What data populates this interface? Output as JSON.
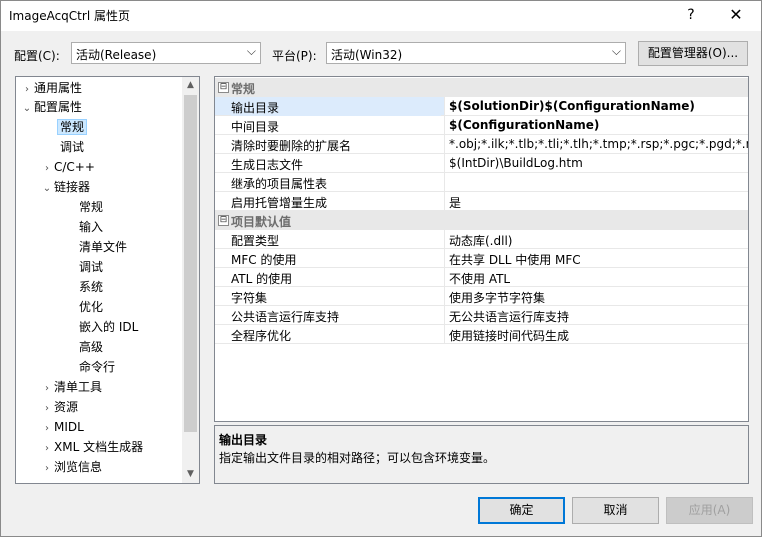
{
  "window": {
    "title": "ImageAcqCtrl 属性页",
    "help": "?",
    "close": "✕"
  },
  "toolbar": {
    "config_label": "配置(C):",
    "config_value": "活动(Release)",
    "platform_label": "平台(P):",
    "platform_value": "活动(Win32)",
    "config_manager": "配置管理器(O)..."
  },
  "tree": {
    "items": [
      {
        "label": "通用属性",
        "expander": "›"
      },
      {
        "label": "配置属性",
        "expander": "⌄"
      },
      {
        "label": "常规"
      },
      {
        "label": "调试"
      },
      {
        "label": "C/C++",
        "expander": "›"
      },
      {
        "label": "链接器",
        "expander": "⌄"
      },
      {
        "label": "常规"
      },
      {
        "label": "输入"
      },
      {
        "label": "清单文件"
      },
      {
        "label": "调试"
      },
      {
        "label": "系统"
      },
      {
        "label": "优化"
      },
      {
        "label": "嵌入的 IDL"
      },
      {
        "label": "高级"
      },
      {
        "label": "命令行"
      },
      {
        "label": "清单工具",
        "expander": "›"
      },
      {
        "label": "资源",
        "expander": "›"
      },
      {
        "label": "MIDL",
        "expander": "›"
      },
      {
        "label": "XML 文档生成器",
        "expander": "›"
      },
      {
        "label": "浏览信息",
        "expander": "›"
      }
    ]
  },
  "grid": {
    "categories": [
      {
        "label": "常规",
        "box": "⊟"
      },
      {
        "label": "项目默认值",
        "box": "⊟"
      }
    ],
    "general": [
      {
        "name": "输出目录",
        "value": "$(SolutionDir)$(ConfigurationName)"
      },
      {
        "name": "中间目录",
        "value": "$(ConfigurationName)"
      },
      {
        "name": "清除时要删除的扩展名",
        "value": "*.obj;*.ilk;*.tlb;*.tli;*.tlh;*.tmp;*.rsp;*.pgc;*.pgd;*.meta;$(TargetPath)"
      },
      {
        "name": "生成日志文件",
        "value": "$(IntDir)\\BuildLog.htm"
      },
      {
        "name": "继承的项目属性表",
        "value": ""
      },
      {
        "name": "启用托管增量生成",
        "value": "是"
      }
    ],
    "defaults": [
      {
        "name": "配置类型",
        "value": "动态库(.dll)"
      },
      {
        "name": "MFC 的使用",
        "value": "在共享 DLL 中使用 MFC"
      },
      {
        "name": "ATL 的使用",
        "value": "不使用 ATL"
      },
      {
        "name": "字符集",
        "value": "使用多字节字符集"
      },
      {
        "name": "公共语言运行库支持",
        "value": "无公共语言运行库支持"
      },
      {
        "name": "全程序优化",
        "value": "使用链接时间代码生成"
      }
    ]
  },
  "description": {
    "title": "输出目录",
    "text": "指定输出文件目录的相对路径；可以包含环境变量。"
  },
  "buttons": {
    "ok": "确定",
    "cancel": "取消",
    "apply": "应用(A)"
  },
  "icons": {
    "combo_arrow": "⌵",
    "scroll_up": "▲",
    "scroll_down": "▼"
  }
}
